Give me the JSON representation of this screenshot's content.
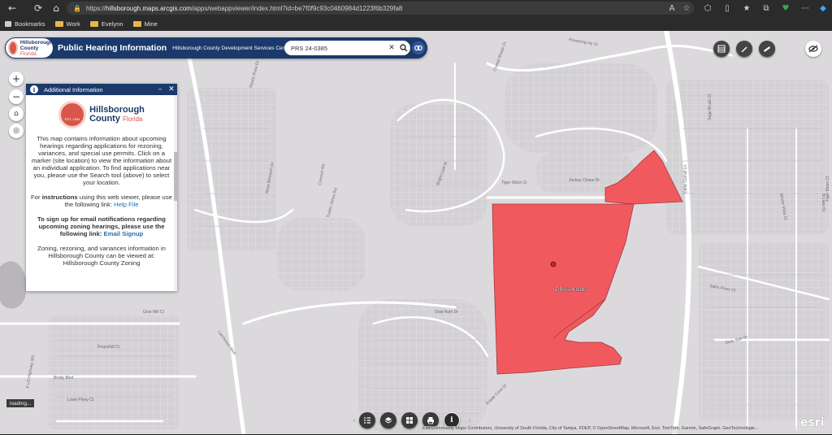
{
  "browser": {
    "url_prefix": "https://",
    "url_host": "hillsborough.maps.arcgis.com",
    "url_path": "/apps/webappviewer/index.html?id=be7f0f9c93c0460984d1223f6b329fa8",
    "bookmarks": [
      {
        "label": "Bookmarks"
      },
      {
        "label": "Work"
      },
      {
        "label": "Evelynn"
      },
      {
        "label": "Mine"
      }
    ]
  },
  "header": {
    "logo_line1": "Hillsborough",
    "logo_line2": "County",
    "logo_line3": "Florida",
    "title": "Public Hearing Information",
    "subtitle": "Hillsborough County Development Services Center",
    "search_value": "PRS 24-0385"
  },
  "panel": {
    "title": "Additional Information",
    "logo_line1": "Hillsborough",
    "logo_line2": "County",
    "logo_line3": "Florida",
    "seal_text": "EST. 1834",
    "para1": "This map contains information about upcoming hearings regarding applications for rezoning, variances, and special use permits. Click on a marker (site location) to view the information about an individual application. To find applications near you, please use the Search tool (above) to select your location.",
    "para2_pre": "For ",
    "para2_bold": "instructions",
    "para2_mid": " using this web viewer, please use the following link: ",
    "para2_link": "Help File",
    "para3_bold": "To sign up for email notifications regarding upcoming zoning hearings, please use the following link: ",
    "para3_link": "Email Signup",
    "para4": "Zoning, rezoning, and variances information in Hillsborough County can be viewed at: Hillsborough County Zoning"
  },
  "map": {
    "parcel_label": "PRS 24-0385",
    "loading": "loading...",
    "attribution": "Esri Community Maps Contributors, University of South Florida, City of Tampa, FDEP, © OpenStreetMap, Microsoft, Esri, TomTom, Garmin, SafeGraph, GeoTechnologie...",
    "esri": "esri",
    "parcel_color": "#f05a5f",
    "street_labels": [
      "Flowering Ivy Ct",
      "Mystic Rose Dr",
      "Crystal Shade Ct",
      "Sage Brush Ct",
      "Tiger Moon Ct",
      "Fawn Birch Dr",
      "Crimson Rd",
      "Tucker Jones Rd",
      "Rose Blossom Dr",
      "Bright Leaf St",
      "Grist Mill Ct",
      "Peacefull Ct",
      "Brody Blvd",
      "Lowe Piney Ct",
      "Oval Rum Dr",
      "Saltiv Pines Ct",
      "Sluis Vale Dr",
      "Larchmont Blvd",
      "Estate Cove Dr",
      "Jockey Chase Dr",
      "Tiger Stitch Ct",
      "Cane Corrall Ln",
      "Winter Vista Ct",
      "N Lake Dr",
      "S US Highway 301"
    ]
  },
  "colors": {
    "header_bg": "#1b3a6b",
    "map_bg": "#dcd9dd",
    "road": "#ffffff",
    "parcel": "#f05a5f"
  }
}
